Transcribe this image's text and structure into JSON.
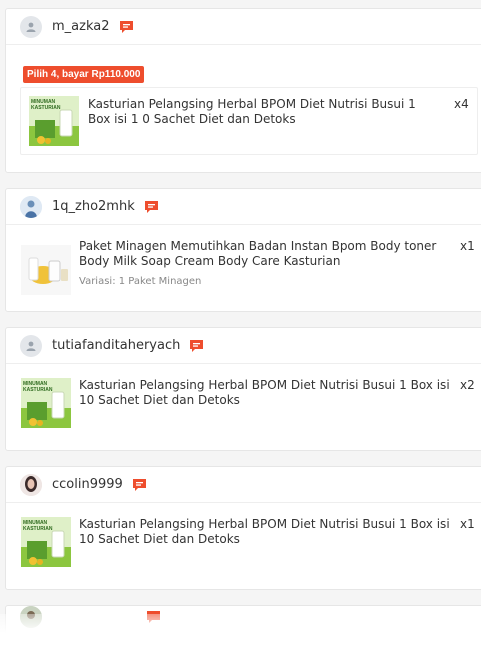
{
  "orders": [
    {
      "username": "m_azka2",
      "avatar_icon": "default-user-icon",
      "promo_badge": "Pilih 4, bayar Rp110.000",
      "product_title": "Kasturian Pelangsing Herbal BPOM Diet Nutrisi Busui 1 Box isi 1 0 Sachet Diet dan Detoks",
      "quantity": "x4",
      "variant": "",
      "thumb_text": "MINUMAN KASTURIAN"
    },
    {
      "username": "1q_zho2mhk",
      "avatar_icon": "photo-avatar-icon",
      "product_title": "Paket Minagen Memutihkan Badan Instan Bpom Body toner Body Milk Soap Cream Body Care Kasturian",
      "quantity": "x1",
      "variant": "Variasi: 1 Paket Minagen"
    },
    {
      "username": "tutiafanditaheryach",
      "avatar_icon": "default-user-icon",
      "product_title": "Kasturian Pelangsing Herbal BPOM Diet Nutrisi Busui 1 Box isi 10 Sachet Diet dan Detoks",
      "quantity": "x2",
      "variant": "",
      "thumb_text": "MINUMAN KASTURIAN"
    },
    {
      "username": "ccolin9999",
      "avatar_icon": "photo-avatar-icon",
      "product_title": "Kasturian Pelangsing Herbal BPOM Diet Nutrisi Busui 1 Box isi 10 Sachet Diet dan Detoks",
      "quantity": "x1",
      "variant": "",
      "thumb_text": "MINUMAN KASTURIAN"
    }
  ],
  "colors": {
    "accent": "#ee4d2d",
    "thumb_green": "#7cc242"
  }
}
